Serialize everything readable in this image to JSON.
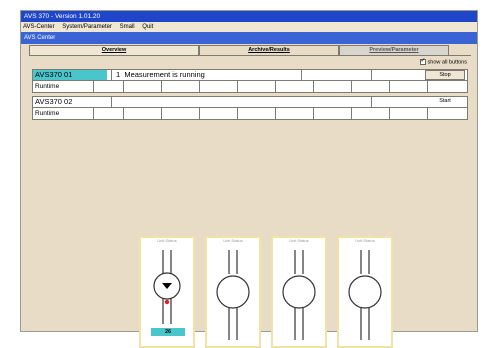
{
  "window": {
    "title": "AVS 370 - Version 1.01.20",
    "subtitle": "AVS Center"
  },
  "menu": [
    "AVS-Center",
    "System/Parameter",
    "Small",
    "Quit"
  ],
  "tabs": [
    {
      "label": "Overview"
    },
    {
      "label": "Archive/Results"
    },
    {
      "label": "Preview/Parameter"
    }
  ],
  "options": {
    "show_all_buttons": "show all buttons",
    "checked": true
  },
  "units": [
    {
      "name": "AVS370 01",
      "status_no": "1",
      "status": "Measurement is running",
      "button": "Stop",
      "row_label": "Runtime"
    },
    {
      "name": "AVS370 02",
      "status_no": "",
      "status": "",
      "button": "Start",
      "row_label": "Runtime"
    }
  ],
  "gauges": [
    {
      "header": "Unit Status",
      "value": "26",
      "active": true
    },
    {
      "header": "Unit Status",
      "value": "",
      "active": false
    },
    {
      "header": "Unit Status",
      "value": "",
      "active": false
    },
    {
      "header": "Unit Status",
      "value": "",
      "active": false
    }
  ]
}
